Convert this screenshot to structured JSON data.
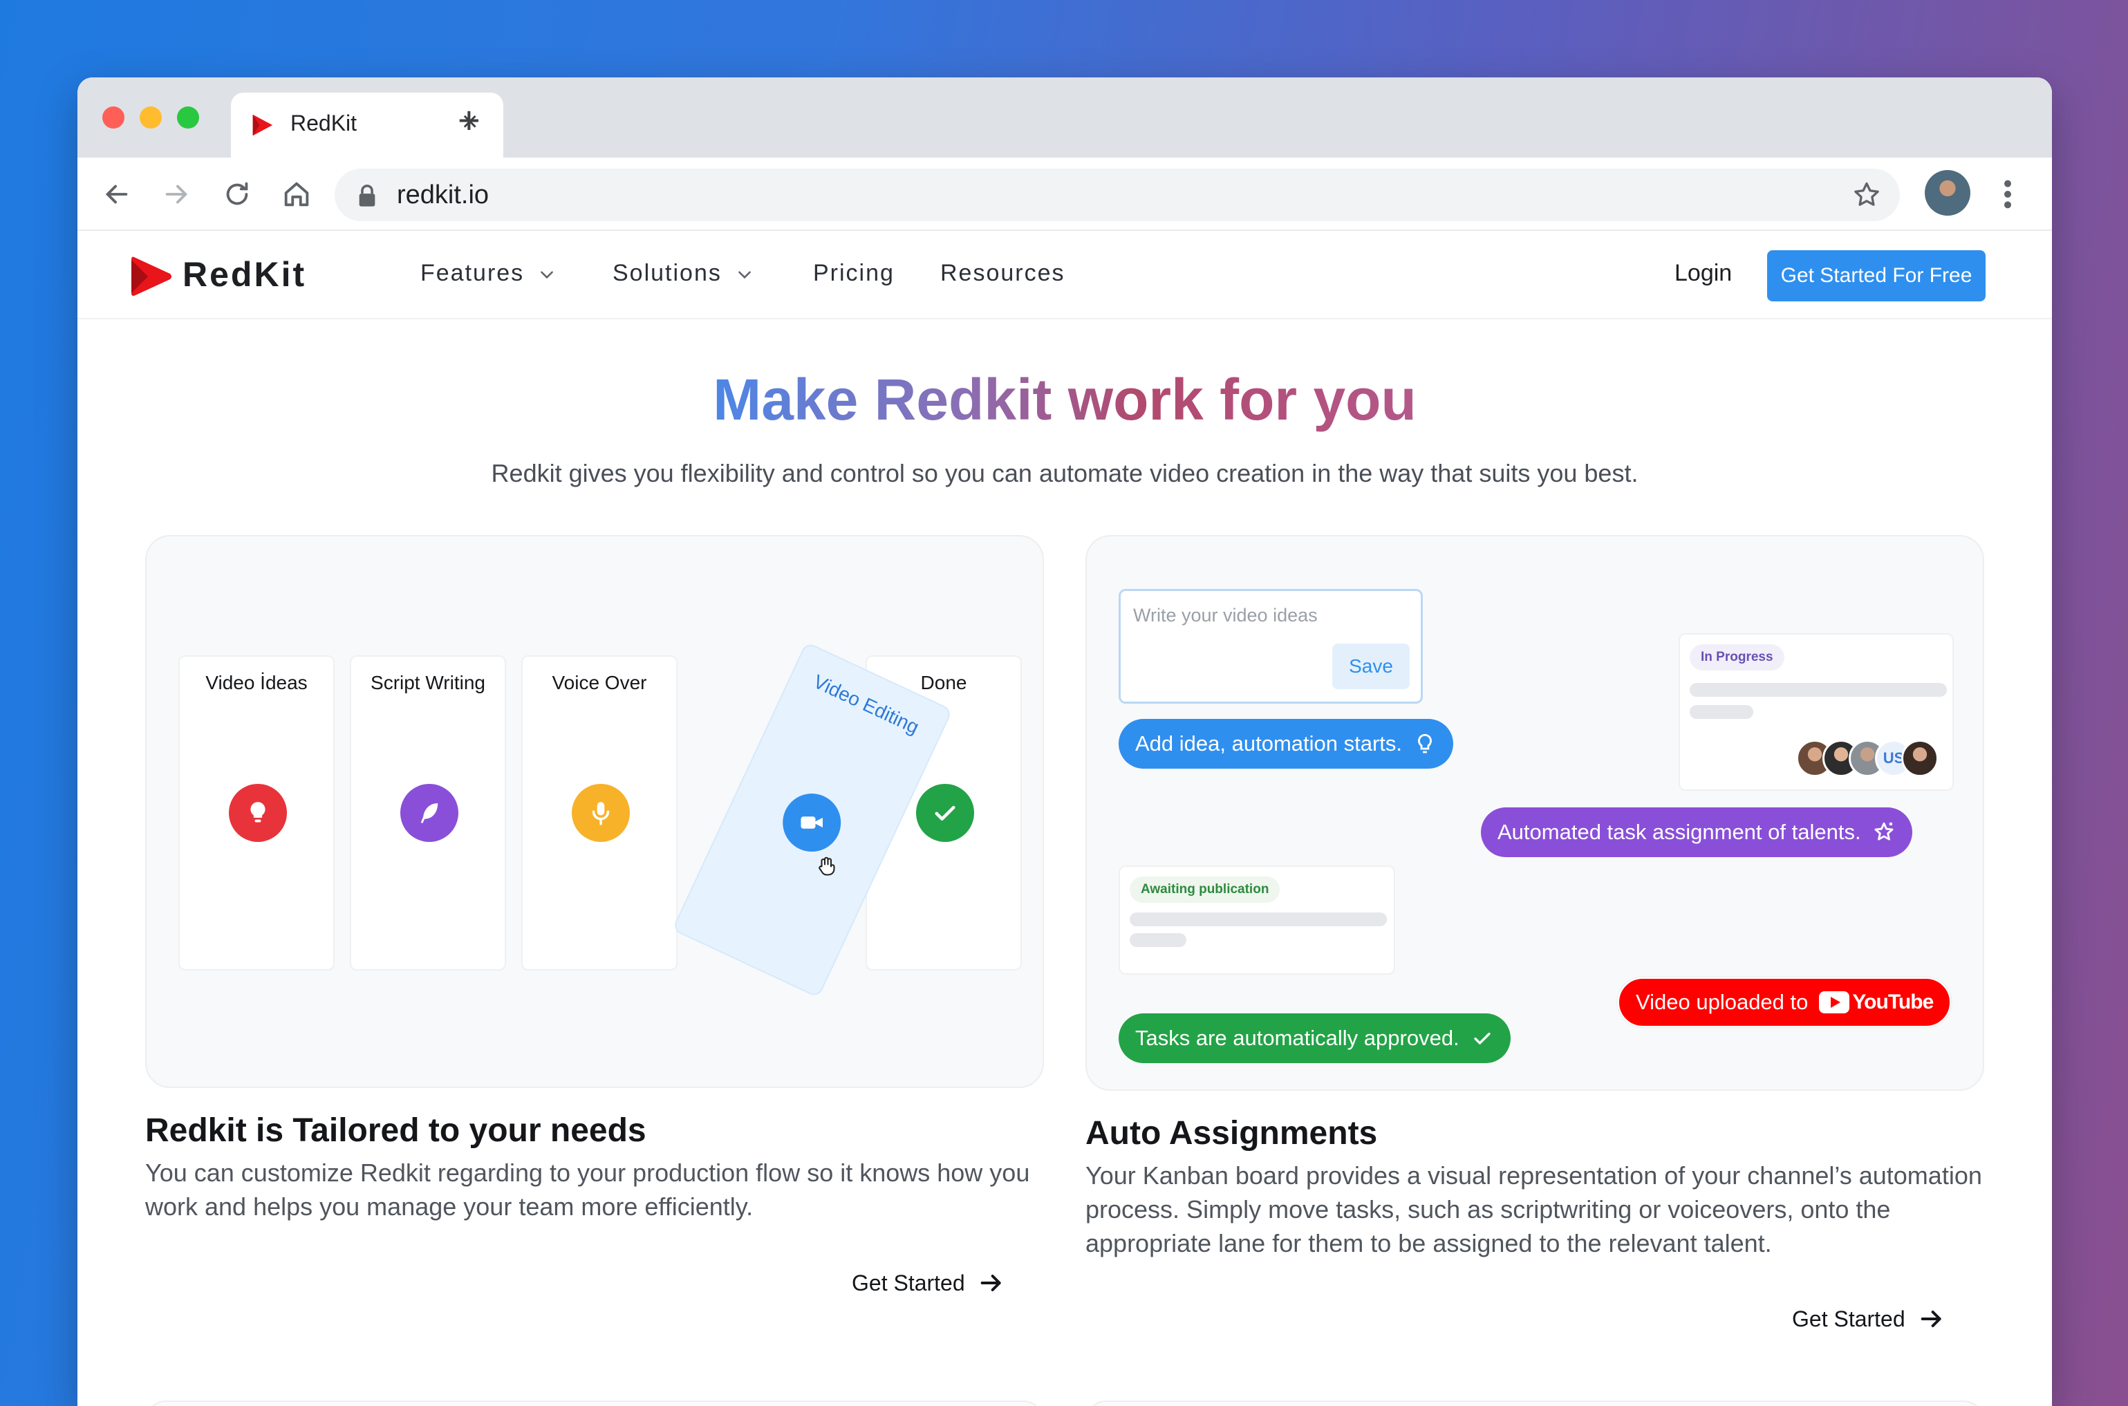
{
  "browser": {
    "tab_title": "RedKit",
    "url": "redkit.io"
  },
  "nav": {
    "brand": "RedKit",
    "items": [
      {
        "label": "Features",
        "has_dropdown": true
      },
      {
        "label": "Solutions",
        "has_dropdown": true
      },
      {
        "label": "Pricing",
        "has_dropdown": false
      },
      {
        "label": "Resources",
        "has_dropdown": false
      }
    ],
    "login": "Login",
    "cta": "Get Started For Free"
  },
  "hero": {
    "title": "Make Redkit work for you",
    "subtitle": "Redkit gives you flexibility and control so you can automate video creation in the way that suits you best."
  },
  "kanban": {
    "lanes": [
      {
        "label": "Video İdeas",
        "icon": "lightbulb-icon",
        "color": "#e8333a"
      },
      {
        "label": "Script Writing",
        "icon": "feather-icon",
        "color": "#8a4fd8"
      },
      {
        "label": "Voice Over",
        "icon": "microphone-icon",
        "color": "#f7b22a"
      },
      {
        "label": "Done",
        "icon": "check-icon",
        "color": "#23a347"
      }
    ],
    "dragging": {
      "label": "Video Editing",
      "icon": "video-camera-icon",
      "color": "#2f8fee"
    }
  },
  "automation": {
    "idea_placeholder": "Write your video ideas",
    "save_label": "Save",
    "pill_add_idea": "Add idea, automation starts.",
    "pill_assignment": "Automated task assignment of talents.",
    "pill_approved": "Tasks are automatically approved.",
    "pill_uploaded": "Video uploaded to",
    "youtube_label": "YouTube",
    "badge_in_progress": "In Progress",
    "badge_awaiting": "Awaiting publication",
    "avatar_more": "US"
  },
  "sections": [
    {
      "title": "Redkit is Tailored to your needs",
      "body": "You can customize Redkit regarding to your production flow so it knows how you work and helps you manage your team more efficiently.",
      "link": "Get Started"
    },
    {
      "title": "Auto Assignments",
      "body": "Your Kanban board provides a visual representation of your channel’s automation process. Simply move tasks, such as scriptwriting or voiceovers, onto the appropriate lane for them to be assigned to the relevant talent.",
      "link": "Get Started"
    }
  ],
  "colors": {
    "accent": "#2f8fee",
    "brand_red": "#ff0000",
    "purple": "#8a4fd8",
    "green": "#23a347"
  }
}
